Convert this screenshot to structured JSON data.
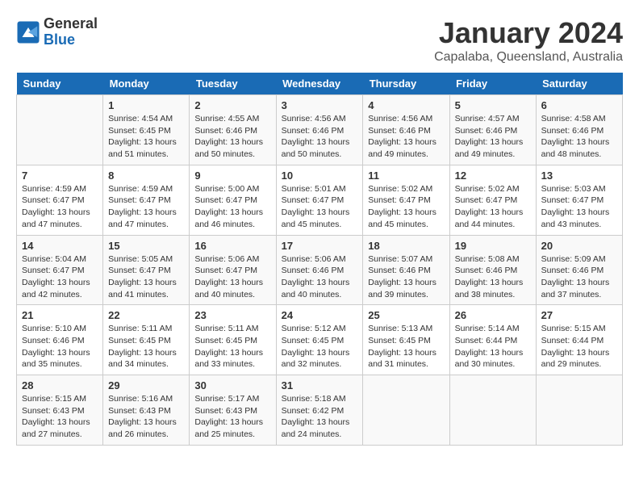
{
  "header": {
    "logo_general": "General",
    "logo_blue": "Blue",
    "month_title": "January 2024",
    "location": "Capalaba, Queensland, Australia"
  },
  "calendar": {
    "days_of_week": [
      "Sunday",
      "Monday",
      "Tuesday",
      "Wednesday",
      "Thursday",
      "Friday",
      "Saturday"
    ],
    "weeks": [
      [
        {
          "day": "",
          "info": ""
        },
        {
          "day": "1",
          "info": "Sunrise: 4:54 AM\nSunset: 6:45 PM\nDaylight: 13 hours\nand 51 minutes."
        },
        {
          "day": "2",
          "info": "Sunrise: 4:55 AM\nSunset: 6:46 PM\nDaylight: 13 hours\nand 50 minutes."
        },
        {
          "day": "3",
          "info": "Sunrise: 4:56 AM\nSunset: 6:46 PM\nDaylight: 13 hours\nand 50 minutes."
        },
        {
          "day": "4",
          "info": "Sunrise: 4:56 AM\nSunset: 6:46 PM\nDaylight: 13 hours\nand 49 minutes."
        },
        {
          "day": "5",
          "info": "Sunrise: 4:57 AM\nSunset: 6:46 PM\nDaylight: 13 hours\nand 49 minutes."
        },
        {
          "day": "6",
          "info": "Sunrise: 4:58 AM\nSunset: 6:46 PM\nDaylight: 13 hours\nand 48 minutes."
        }
      ],
      [
        {
          "day": "7",
          "info": "Sunrise: 4:59 AM\nSunset: 6:47 PM\nDaylight: 13 hours\nand 47 minutes."
        },
        {
          "day": "8",
          "info": "Sunrise: 4:59 AM\nSunset: 6:47 PM\nDaylight: 13 hours\nand 47 minutes."
        },
        {
          "day": "9",
          "info": "Sunrise: 5:00 AM\nSunset: 6:47 PM\nDaylight: 13 hours\nand 46 minutes."
        },
        {
          "day": "10",
          "info": "Sunrise: 5:01 AM\nSunset: 6:47 PM\nDaylight: 13 hours\nand 45 minutes."
        },
        {
          "day": "11",
          "info": "Sunrise: 5:02 AM\nSunset: 6:47 PM\nDaylight: 13 hours\nand 45 minutes."
        },
        {
          "day": "12",
          "info": "Sunrise: 5:02 AM\nSunset: 6:47 PM\nDaylight: 13 hours\nand 44 minutes."
        },
        {
          "day": "13",
          "info": "Sunrise: 5:03 AM\nSunset: 6:47 PM\nDaylight: 13 hours\nand 43 minutes."
        }
      ],
      [
        {
          "day": "14",
          "info": "Sunrise: 5:04 AM\nSunset: 6:47 PM\nDaylight: 13 hours\nand 42 minutes."
        },
        {
          "day": "15",
          "info": "Sunrise: 5:05 AM\nSunset: 6:47 PM\nDaylight: 13 hours\nand 41 minutes."
        },
        {
          "day": "16",
          "info": "Sunrise: 5:06 AM\nSunset: 6:47 PM\nDaylight: 13 hours\nand 40 minutes."
        },
        {
          "day": "17",
          "info": "Sunrise: 5:06 AM\nSunset: 6:46 PM\nDaylight: 13 hours\nand 40 minutes."
        },
        {
          "day": "18",
          "info": "Sunrise: 5:07 AM\nSunset: 6:46 PM\nDaylight: 13 hours\nand 39 minutes."
        },
        {
          "day": "19",
          "info": "Sunrise: 5:08 AM\nSunset: 6:46 PM\nDaylight: 13 hours\nand 38 minutes."
        },
        {
          "day": "20",
          "info": "Sunrise: 5:09 AM\nSunset: 6:46 PM\nDaylight: 13 hours\nand 37 minutes."
        }
      ],
      [
        {
          "day": "21",
          "info": "Sunrise: 5:10 AM\nSunset: 6:46 PM\nDaylight: 13 hours\nand 35 minutes."
        },
        {
          "day": "22",
          "info": "Sunrise: 5:11 AM\nSunset: 6:45 PM\nDaylight: 13 hours\nand 34 minutes."
        },
        {
          "day": "23",
          "info": "Sunrise: 5:11 AM\nSunset: 6:45 PM\nDaylight: 13 hours\nand 33 minutes."
        },
        {
          "day": "24",
          "info": "Sunrise: 5:12 AM\nSunset: 6:45 PM\nDaylight: 13 hours\nand 32 minutes."
        },
        {
          "day": "25",
          "info": "Sunrise: 5:13 AM\nSunset: 6:45 PM\nDaylight: 13 hours\nand 31 minutes."
        },
        {
          "day": "26",
          "info": "Sunrise: 5:14 AM\nSunset: 6:44 PM\nDaylight: 13 hours\nand 30 minutes."
        },
        {
          "day": "27",
          "info": "Sunrise: 5:15 AM\nSunset: 6:44 PM\nDaylight: 13 hours\nand 29 minutes."
        }
      ],
      [
        {
          "day": "28",
          "info": "Sunrise: 5:15 AM\nSunset: 6:43 PM\nDaylight: 13 hours\nand 27 minutes."
        },
        {
          "day": "29",
          "info": "Sunrise: 5:16 AM\nSunset: 6:43 PM\nDaylight: 13 hours\nand 26 minutes."
        },
        {
          "day": "30",
          "info": "Sunrise: 5:17 AM\nSunset: 6:43 PM\nDaylight: 13 hours\nand 25 minutes."
        },
        {
          "day": "31",
          "info": "Sunrise: 5:18 AM\nSunset: 6:42 PM\nDaylight: 13 hours\nand 24 minutes."
        },
        {
          "day": "",
          "info": ""
        },
        {
          "day": "",
          "info": ""
        },
        {
          "day": "",
          "info": ""
        }
      ]
    ]
  }
}
